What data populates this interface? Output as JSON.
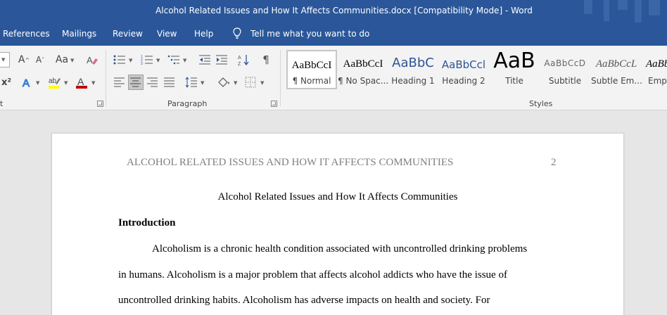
{
  "window": {
    "title": "Alcohol Related Issues and How It Affects Communities.docx [Compatibility Mode]  -  Word"
  },
  "tabs": {
    "references": "References",
    "mailings": "Mailings",
    "review": "Review",
    "view": "View",
    "help": "Help",
    "tell_me": "Tell me what you want to do"
  },
  "ribbon": {
    "font_group_label_fragment": "t",
    "paragraph_group_label": "Paragraph",
    "styles_group_label": "Styles",
    "styles": [
      {
        "sample": "AaBbCcI",
        "name": "¶ Normal"
      },
      {
        "sample": "AaBbCcI",
        "name": "¶ No Spac..."
      },
      {
        "sample": "AaBbC",
        "name": "Heading 1"
      },
      {
        "sample": "AaBbCcl",
        "name": "Heading 2"
      },
      {
        "sample": "AaB",
        "name": "Title"
      },
      {
        "sample": "AaBbCcD",
        "name": "Subtitle"
      },
      {
        "sample": "AaBbCcL",
        "name": "Subtle Em..."
      },
      {
        "sample": "AaBbC",
        "name": "Emph"
      }
    ],
    "colors": {
      "highlight": "#ffff00",
      "font_color": "#c00000"
    },
    "font_buttons": {
      "case": "Aa",
      "grow": "A",
      "shrink": "A",
      "text_effects": "A",
      "highlight": "ab",
      "font_color": "A",
      "superscript": "x²"
    }
  },
  "document": {
    "running_head": "ALCOHOL RELATED ISSUES AND HOW IT AFFECTS COMMUNITIES",
    "page_number": "2",
    "title": "Alcohol Related Issues and How It Affects Communities",
    "heading": "Introduction",
    "lines": [
      "Alcoholism is a chronic health condition associated with uncontrolled drinking problems",
      "in humans. Alcoholism is a major problem that affects alcohol addicts who have the issue of",
      "uncontrolled drinking habits. Alcoholism has adverse impacts on health and society. For"
    ]
  },
  "theme": {
    "accent": "#2b579a"
  }
}
